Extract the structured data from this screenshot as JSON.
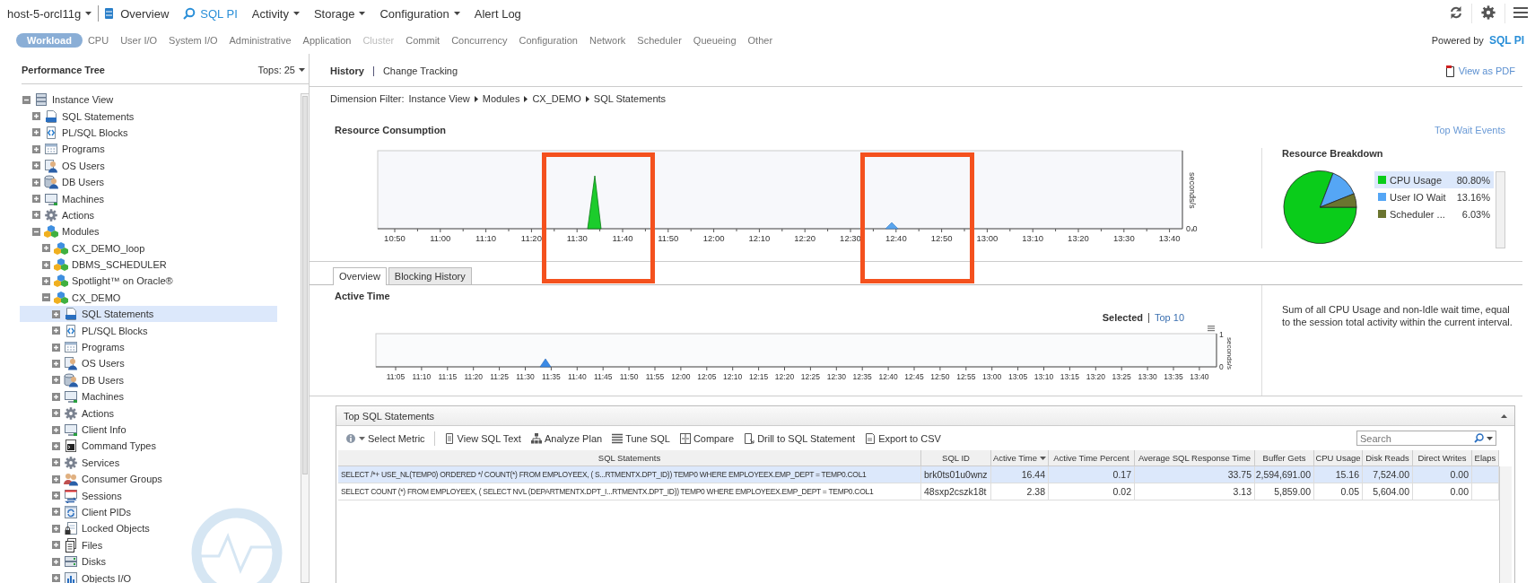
{
  "top_bar": {
    "host": "host-5-orcl11g",
    "nav": [
      {
        "label": "Overview",
        "kind": "link",
        "selected": false
      },
      {
        "label": "SQL PI",
        "kind": "product",
        "selected": true
      },
      {
        "label": "Activity",
        "kind": "menu",
        "selected": false
      },
      {
        "label": "Storage",
        "kind": "menu",
        "selected": false
      },
      {
        "label": "Configuration",
        "kind": "menu",
        "selected": false
      },
      {
        "label": "Alert Log",
        "kind": "link",
        "selected": false
      }
    ]
  },
  "categories": {
    "items": [
      {
        "label": "Workload",
        "selected": true,
        "disabled": false
      },
      {
        "label": "CPU",
        "selected": false,
        "disabled": false
      },
      {
        "label": "User I/O",
        "selected": false,
        "disabled": false
      },
      {
        "label": "System I/O",
        "selected": false,
        "disabled": false
      },
      {
        "label": "Administrative",
        "selected": false,
        "disabled": false
      },
      {
        "label": "Application",
        "selected": false,
        "disabled": false
      },
      {
        "label": "Cluster",
        "selected": false,
        "disabled": true
      },
      {
        "label": "Commit",
        "selected": false,
        "disabled": false
      },
      {
        "label": "Concurrency",
        "selected": false,
        "disabled": false
      },
      {
        "label": "Configuration",
        "selected": false,
        "disabled": false
      },
      {
        "label": "Network",
        "selected": false,
        "disabled": false
      },
      {
        "label": "Scheduler",
        "selected": false,
        "disabled": false
      },
      {
        "label": "Queueing",
        "selected": false,
        "disabled": false
      },
      {
        "label": "Other",
        "selected": false,
        "disabled": false
      }
    ],
    "powered_by": "Powered by",
    "logo": "SQL PI"
  },
  "performance_tree": {
    "title": "Performance Tree",
    "tops": "Tops: 25",
    "items": [
      {
        "label": "Instance View",
        "kind": "instance",
        "expanded": true,
        "selected": false,
        "children": [
          {
            "label": "SQL Statements",
            "kind": "sql",
            "expanded": false,
            "selected": false
          },
          {
            "label": "PL/SQL Blocks",
            "kind": "code",
            "expanded": false,
            "selected": false
          },
          {
            "label": "Programs",
            "kind": "grid",
            "expanded": false,
            "selected": false
          },
          {
            "label": "OS Users",
            "kind": "user",
            "expanded": false,
            "selected": false
          },
          {
            "label": "DB Users",
            "kind": "dbuser",
            "expanded": false,
            "selected": false
          },
          {
            "label": "Machines",
            "kind": "monitor",
            "expanded": false,
            "selected": false
          },
          {
            "label": "Actions",
            "kind": "gear",
            "expanded": false,
            "selected": false
          },
          {
            "label": "Modules",
            "kind": "modules",
            "expanded": true,
            "selected": false,
            "children": [
              {
                "label": "CX_DEMO_loop",
                "kind": "modules",
                "expanded": false,
                "selected": false
              },
              {
                "label": "DBMS_SCHEDULER",
                "kind": "modules",
                "expanded": false,
                "selected": false
              },
              {
                "label": "Spotlight™ on Oracle®",
                "kind": "modules",
                "expanded": false,
                "selected": false
              },
              {
                "label": "CX_DEMO",
                "kind": "modules",
                "expanded": true,
                "selected": false,
                "children": [
                  {
                    "label": "SQL Statements",
                    "kind": "sql",
                    "expanded": false,
                    "selected": true
                  },
                  {
                    "label": "PL/SQL Blocks",
                    "kind": "code",
                    "expanded": false,
                    "selected": false
                  },
                  {
                    "label": "Programs",
                    "kind": "grid",
                    "expanded": false,
                    "selected": false
                  },
                  {
                    "label": "OS Users",
                    "kind": "user",
                    "expanded": false,
                    "selected": false
                  },
                  {
                    "label": "DB Users",
                    "kind": "dbuser",
                    "expanded": false,
                    "selected": false
                  },
                  {
                    "label": "Machines",
                    "kind": "monitor",
                    "expanded": false,
                    "selected": false
                  },
                  {
                    "label": "Actions",
                    "kind": "gear",
                    "expanded": false,
                    "selected": false
                  },
                  {
                    "label": "Client Info",
                    "kind": "monitor",
                    "expanded": false,
                    "selected": false
                  },
                  {
                    "label": "Command Types",
                    "kind": "terminal",
                    "expanded": false,
                    "selected": false
                  },
                  {
                    "label": "Services",
                    "kind": "gear",
                    "expanded": false,
                    "selected": false
                  },
                  {
                    "label": "Consumer Groups",
                    "kind": "group",
                    "expanded": false,
                    "selected": false
                  },
                  {
                    "label": "Sessions",
                    "kind": "sessions",
                    "expanded": false,
                    "selected": false
                  },
                  {
                    "label": "Client PIDs",
                    "kind": "pid",
                    "expanded": false,
                    "selected": false
                  },
                  {
                    "label": "Locked Objects",
                    "kind": "lock",
                    "expanded": false,
                    "selected": false
                  },
                  {
                    "label": "Files",
                    "kind": "files",
                    "expanded": false,
                    "selected": false
                  },
                  {
                    "label": "Disks",
                    "kind": "disks",
                    "expanded": false,
                    "selected": false
                  },
                  {
                    "label": "Objects I/O",
                    "kind": "io",
                    "expanded": false,
                    "selected": false
                  }
                ]
              }
            ]
          }
        ]
      }
    ]
  },
  "history": {
    "tabs": [
      {
        "label": "History",
        "selected": true
      },
      {
        "label": "Change Tracking",
        "selected": false
      }
    ],
    "pdf_link": "View as PDF",
    "breadcrumb": {
      "label": "Dimension Filter:",
      "items": [
        "Instance View",
        "Modules",
        "CX_DEMO",
        "SQL Statements"
      ]
    }
  },
  "resource_consumption": {
    "title": "Resource Consumption",
    "top_wait_events": "Top Wait Events",
    "y_unit": "seconds/s",
    "y_tick": "0.0",
    "x_ticks": [
      "10:50",
      "11:00",
      "11:10",
      "11:20",
      "11:30",
      "11:40",
      "11:50",
      "12:00",
      "12:10",
      "12:20",
      "12:30",
      "12:40",
      "12:50",
      "13:00",
      "13:10",
      "13:20",
      "13:30",
      "13:40"
    ]
  },
  "resource_breakdown": {
    "chart_data": {
      "type": "pie",
      "title": "Resource Breakdown",
      "categories": [
        "CPU Usage",
        "User IO Wait",
        "Scheduler ..."
      ],
      "values": [
        80.8,
        13.16,
        6.03
      ]
    },
    "legend": [
      {
        "reading": "80.80%",
        "color": "#0acc1a",
        "selected": true
      },
      {
        "reading": "13.16%",
        "color": "#55a6f5",
        "selected": false
      },
      {
        "reading": "6.03%",
        "color": "#6b7530",
        "selected": false
      }
    ]
  },
  "detail_tabs": [
    {
      "label": "Overview",
      "selected": true
    },
    {
      "label": "Blocking History",
      "selected": false
    }
  ],
  "active_time": {
    "title": "Active Time",
    "filters": [
      {
        "label": "Selected",
        "selected": true
      },
      {
        "label": "Top 10",
        "selected": false
      }
    ],
    "y_unit": "seconds/s",
    "y_ticks": [
      "1",
      "0"
    ],
    "x_ticks": [
      "11:05",
      "11:10",
      "11:15",
      "11:20",
      "11:25",
      "11:30",
      "11:35",
      "11:40",
      "11:45",
      "11:50",
      "11:55",
      "12:00",
      "12:05",
      "12:10",
      "12:15",
      "12:20",
      "12:25",
      "12:30",
      "12:35",
      "12:40",
      "12:45",
      "12:50",
      "12:55",
      "13:00",
      "13:05",
      "13:10",
      "13:15",
      "13:20",
      "13:25",
      "13:30",
      "13:35",
      "13:40"
    ],
    "description": "Sum of all CPU Usage and non-Idle wait time, equal to the session total activity within the current interval."
  },
  "top_sql": {
    "title": "Top SQL Statements",
    "toolbar": [
      {
        "label": "Select Metric",
        "kind": "metric"
      },
      {
        "label": "View SQL Text",
        "kind": "document"
      },
      {
        "label": "Analyze Plan",
        "kind": "hierarchy"
      },
      {
        "label": "Tune SQL",
        "kind": "list"
      },
      {
        "label": "Compare",
        "kind": "compare"
      },
      {
        "label": "Drill to SQL Statement",
        "kind": "drill"
      },
      {
        "label": "Export to CSV",
        "kind": "csv"
      }
    ],
    "search": {
      "placeholder": "Search"
    },
    "columns": [
      {
        "label": "SQL Statements",
        "sorted": false
      },
      {
        "label": "SQL ID",
        "sorted": false
      },
      {
        "label": "Active Time",
        "sorted": true
      },
      {
        "label": "Active Time Percent",
        "sorted": false
      },
      {
        "label": "Average SQL Response Time",
        "sorted": false
      },
      {
        "label": "Buffer Gets",
        "sorted": false
      },
      {
        "label": "CPU Usage",
        "sorted": false
      },
      {
        "label": "Disk Reads",
        "sorted": false
      },
      {
        "label": "Direct Writes",
        "sorted": false
      },
      {
        "label": "Elaps",
        "sorted": false
      }
    ],
    "rows": [
      {
        "selected": true,
        "cells": [
          "SELECT /*+ USE_NL(TEMP0) ORDERED */ COUNT(*) FROM EMPLOYEEX, ( S...RTMENTX.DPT_ID)) TEMP0 WHERE EMPLOYEEX.EMP_DEPT = TEMP0.COL1",
          "brk0ts01u0wnz",
          "16.44",
          "0.17",
          "33.75",
          "2,594,691.00",
          "15.16",
          "7,524.00",
          "0.00"
        ]
      },
      {
        "selected": false,
        "cells": [
          "SELECT COUNT (*) FROM EMPLOYEEX, ( SELECT NVL (DEPARTMENTX.DPT_I...RTMENTX.DPT_ID)) TEMP0 WHERE EMPLOYEEX.EMP_DEPT = TEMP0.COL1",
          "48sxp2cszk18t",
          "2.38",
          "0.02",
          "3.13",
          "5,859.00",
          "0.05",
          "5,604.00",
          "0.00"
        ]
      }
    ]
  }
}
